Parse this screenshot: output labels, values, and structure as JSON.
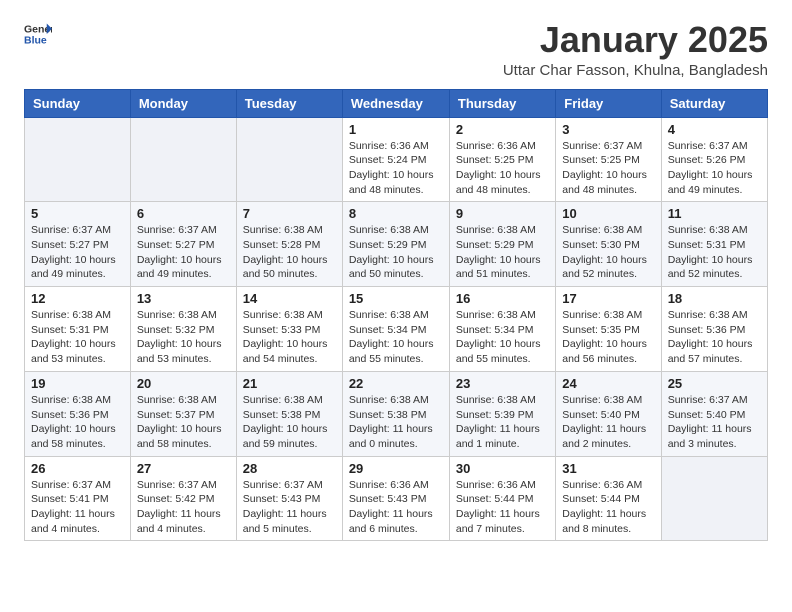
{
  "header": {
    "logo_general": "General",
    "logo_blue": "Blue",
    "month_title": "January 2025",
    "location": "Uttar Char Fasson, Khulna, Bangladesh"
  },
  "weekdays": [
    "Sunday",
    "Monday",
    "Tuesday",
    "Wednesday",
    "Thursday",
    "Friday",
    "Saturday"
  ],
  "weeks": [
    [
      {
        "day": "",
        "empty": true
      },
      {
        "day": "",
        "empty": true
      },
      {
        "day": "",
        "empty": true
      },
      {
        "day": "1",
        "sunrise": "6:36 AM",
        "sunset": "5:24 PM",
        "daylight": "10 hours and 48 minutes."
      },
      {
        "day": "2",
        "sunrise": "6:36 AM",
        "sunset": "5:25 PM",
        "daylight": "10 hours and 48 minutes."
      },
      {
        "day": "3",
        "sunrise": "6:37 AM",
        "sunset": "5:25 PM",
        "daylight": "10 hours and 48 minutes."
      },
      {
        "day": "4",
        "sunrise": "6:37 AM",
        "sunset": "5:26 PM",
        "daylight": "10 hours and 49 minutes."
      }
    ],
    [
      {
        "day": "5",
        "sunrise": "6:37 AM",
        "sunset": "5:27 PM",
        "daylight": "10 hours and 49 minutes."
      },
      {
        "day": "6",
        "sunrise": "6:37 AM",
        "sunset": "5:27 PM",
        "daylight": "10 hours and 49 minutes."
      },
      {
        "day": "7",
        "sunrise": "6:38 AM",
        "sunset": "5:28 PM",
        "daylight": "10 hours and 50 minutes."
      },
      {
        "day": "8",
        "sunrise": "6:38 AM",
        "sunset": "5:29 PM",
        "daylight": "10 hours and 50 minutes."
      },
      {
        "day": "9",
        "sunrise": "6:38 AM",
        "sunset": "5:29 PM",
        "daylight": "10 hours and 51 minutes."
      },
      {
        "day": "10",
        "sunrise": "6:38 AM",
        "sunset": "5:30 PM",
        "daylight": "10 hours and 52 minutes."
      },
      {
        "day": "11",
        "sunrise": "6:38 AM",
        "sunset": "5:31 PM",
        "daylight": "10 hours and 52 minutes."
      }
    ],
    [
      {
        "day": "12",
        "sunrise": "6:38 AM",
        "sunset": "5:31 PM",
        "daylight": "10 hours and 53 minutes."
      },
      {
        "day": "13",
        "sunrise": "6:38 AM",
        "sunset": "5:32 PM",
        "daylight": "10 hours and 53 minutes."
      },
      {
        "day": "14",
        "sunrise": "6:38 AM",
        "sunset": "5:33 PM",
        "daylight": "10 hours and 54 minutes."
      },
      {
        "day": "15",
        "sunrise": "6:38 AM",
        "sunset": "5:34 PM",
        "daylight": "10 hours and 55 minutes."
      },
      {
        "day": "16",
        "sunrise": "6:38 AM",
        "sunset": "5:34 PM",
        "daylight": "10 hours and 55 minutes."
      },
      {
        "day": "17",
        "sunrise": "6:38 AM",
        "sunset": "5:35 PM",
        "daylight": "10 hours and 56 minutes."
      },
      {
        "day": "18",
        "sunrise": "6:38 AM",
        "sunset": "5:36 PM",
        "daylight": "10 hours and 57 minutes."
      }
    ],
    [
      {
        "day": "19",
        "sunrise": "6:38 AM",
        "sunset": "5:36 PM",
        "daylight": "10 hours and 58 minutes."
      },
      {
        "day": "20",
        "sunrise": "6:38 AM",
        "sunset": "5:37 PM",
        "daylight": "10 hours and 58 minutes."
      },
      {
        "day": "21",
        "sunrise": "6:38 AM",
        "sunset": "5:38 PM",
        "daylight": "10 hours and 59 minutes."
      },
      {
        "day": "22",
        "sunrise": "6:38 AM",
        "sunset": "5:38 PM",
        "daylight": "11 hours and 0 minutes."
      },
      {
        "day": "23",
        "sunrise": "6:38 AM",
        "sunset": "5:39 PM",
        "daylight": "11 hours and 1 minute."
      },
      {
        "day": "24",
        "sunrise": "6:38 AM",
        "sunset": "5:40 PM",
        "daylight": "11 hours and 2 minutes."
      },
      {
        "day": "25",
        "sunrise": "6:37 AM",
        "sunset": "5:40 PM",
        "daylight": "11 hours and 3 minutes."
      }
    ],
    [
      {
        "day": "26",
        "sunrise": "6:37 AM",
        "sunset": "5:41 PM",
        "daylight": "11 hours and 4 minutes."
      },
      {
        "day": "27",
        "sunrise": "6:37 AM",
        "sunset": "5:42 PM",
        "daylight": "11 hours and 4 minutes."
      },
      {
        "day": "28",
        "sunrise": "6:37 AM",
        "sunset": "5:43 PM",
        "daylight": "11 hours and 5 minutes."
      },
      {
        "day": "29",
        "sunrise": "6:36 AM",
        "sunset": "5:43 PM",
        "daylight": "11 hours and 6 minutes."
      },
      {
        "day": "30",
        "sunrise": "6:36 AM",
        "sunset": "5:44 PM",
        "daylight": "11 hours and 7 minutes."
      },
      {
        "day": "31",
        "sunrise": "6:36 AM",
        "sunset": "5:44 PM",
        "daylight": "11 hours and 8 minutes."
      },
      {
        "day": "",
        "empty": true
      }
    ]
  ],
  "labels": {
    "sunrise": "Sunrise:",
    "sunset": "Sunset:",
    "daylight": "Daylight:"
  }
}
